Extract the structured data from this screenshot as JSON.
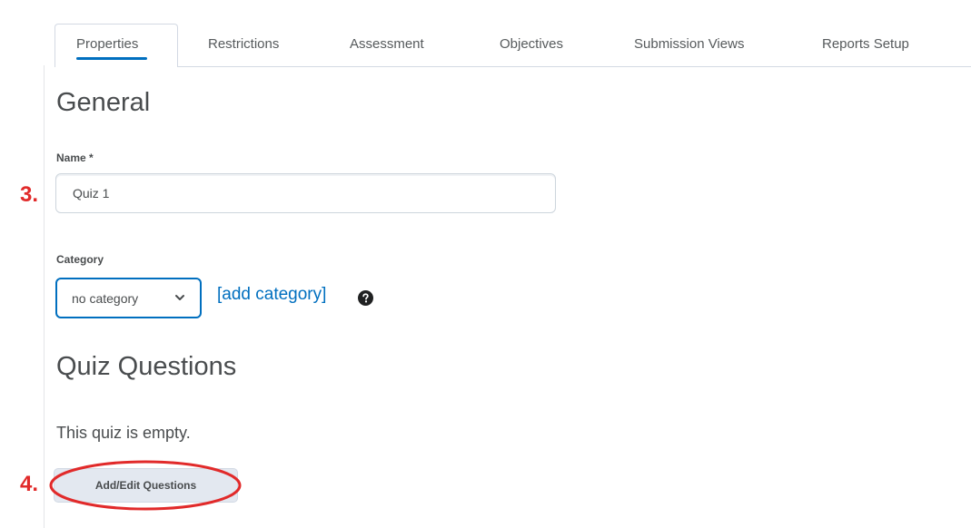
{
  "tabs": [
    {
      "label": "Properties",
      "active": true
    },
    {
      "label": "Restrictions",
      "active": false
    },
    {
      "label": "Assessment",
      "active": false
    },
    {
      "label": "Objectives",
      "active": false
    },
    {
      "label": "Submission Views",
      "active": false
    },
    {
      "label": "Reports Setup",
      "active": false
    }
  ],
  "general": {
    "heading": "General",
    "name_label": "Name *",
    "name_value": "Quiz 1",
    "category_label": "Category",
    "category_selected": "no category",
    "add_category_link": "[add category]",
    "help_icon": "help-circle-icon"
  },
  "quiz_questions": {
    "heading": "Quiz Questions",
    "empty_text": "This quiz is empty.",
    "add_edit_button": "Add/Edit Questions"
  },
  "annotations": {
    "step_3": "3.",
    "step_4": "4.",
    "color": "#e12a2a"
  },
  "colors": {
    "accent": "#006fbf",
    "text": "#494c4e",
    "annotation_red": "#e12a2a"
  }
}
